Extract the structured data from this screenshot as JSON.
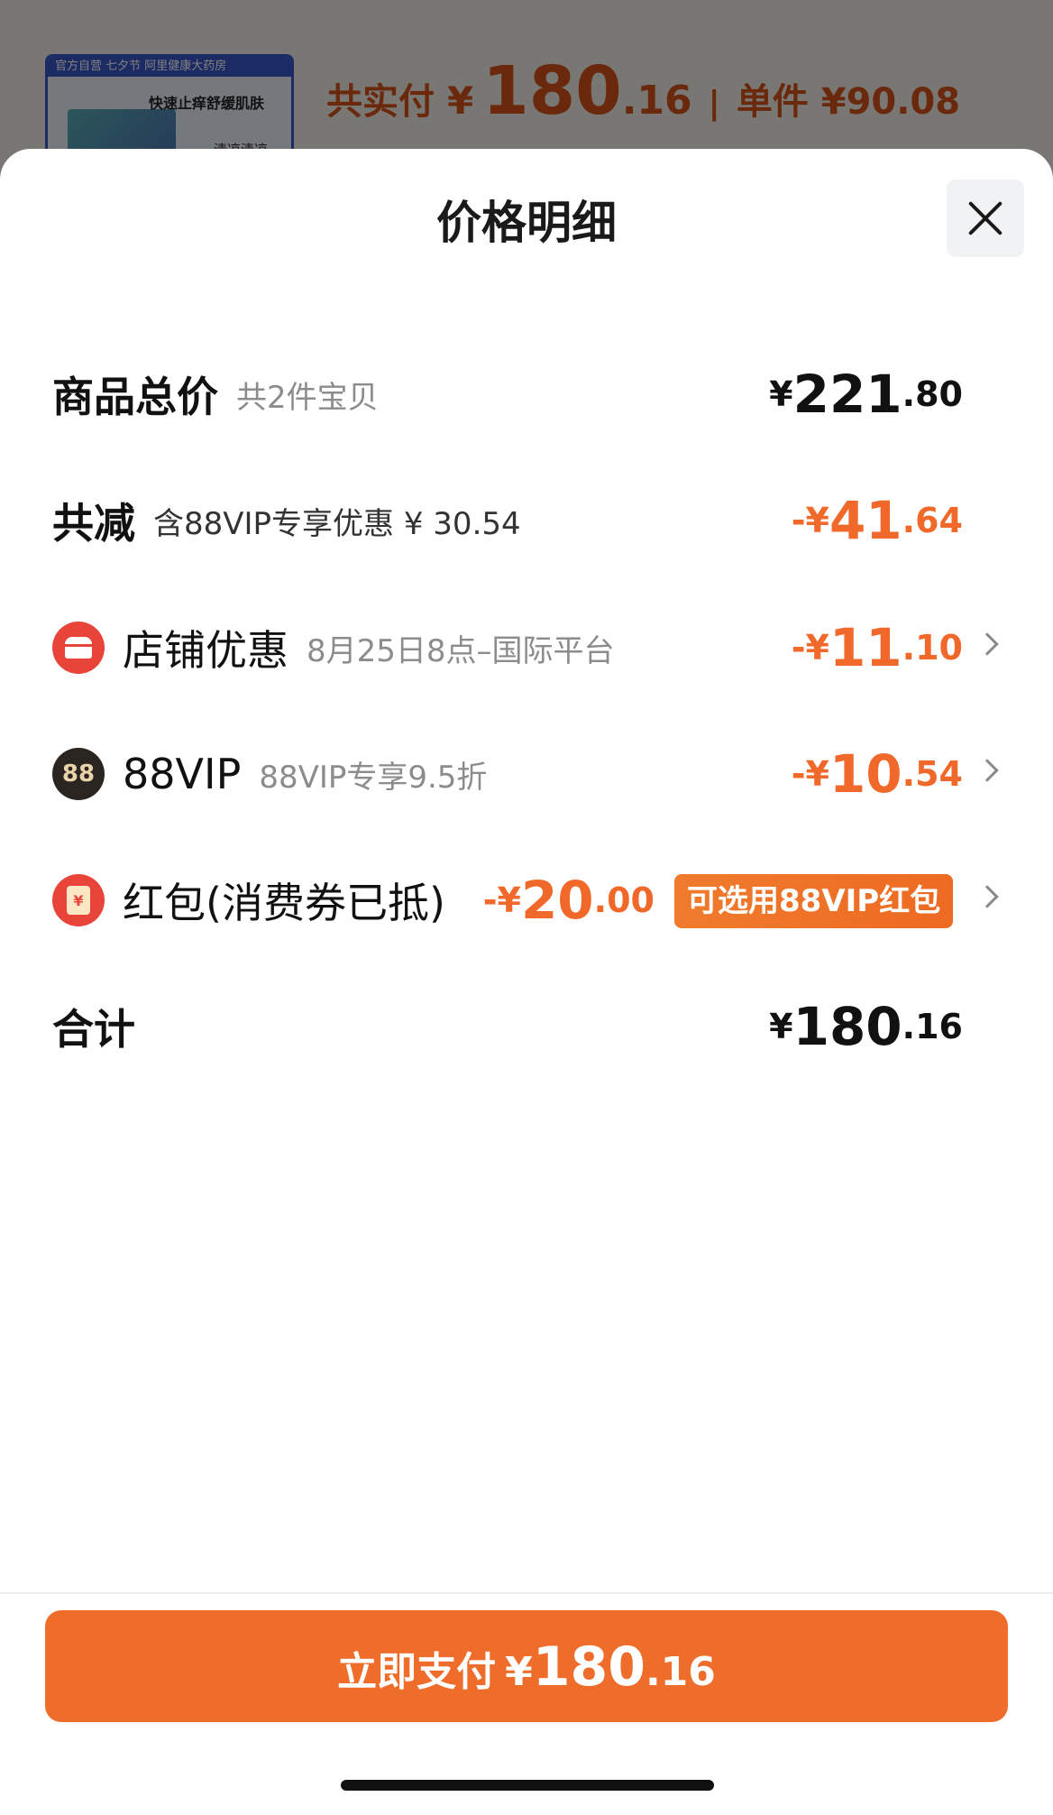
{
  "background": {
    "product_tag": "官方自营 七夕节 阿里健康大药房",
    "product_line1": "快速止痒舒缓肌肤",
    "product_line2": "清凉清凉",
    "total_label": "共实付",
    "total_currency": "¥",
    "total_int": "180",
    "total_dec": ".16",
    "separator": "|",
    "unit_label": "单件 ¥90.08"
  },
  "sheet": {
    "title": "价格明细",
    "close_icon": "close-icon"
  },
  "rows": [
    {
      "label": "商品总价",
      "sub": "共2件宝贝",
      "currency": "¥",
      "int": "221",
      "dec": ".80"
    },
    {
      "label": "共减",
      "sub": "含88VIP专享优惠 ¥ 30.54",
      "currency": "-¥",
      "int": "41",
      "dec": ".64"
    },
    {
      "icon": "store-icon",
      "label": "店铺优惠",
      "sub": "8月25日8点–国际平台",
      "currency": "-¥",
      "int": "11",
      "dec": ".10"
    },
    {
      "icon": "vip-icon",
      "icon_text": "88",
      "label": "88VIP",
      "sub": "88VIP专享9.5折",
      "currency": "-¥",
      "int": "10",
      "dec": ".54"
    },
    {
      "icon": "red-packet-icon",
      "icon_text": "¥",
      "label": "红包(消费券已抵)",
      "currency": "-¥",
      "int": "20",
      "dec": ".00",
      "badge": "可选用88VIP红包"
    },
    {
      "label": "合计",
      "currency": "¥",
      "int": "180",
      "dec": ".16"
    }
  ],
  "pay_button": {
    "label": "立即支付",
    "currency": "¥",
    "int": "180",
    "dec": ".16"
  },
  "colors": {
    "accent": "#ee6d2b",
    "discount": "#f0682a"
  }
}
